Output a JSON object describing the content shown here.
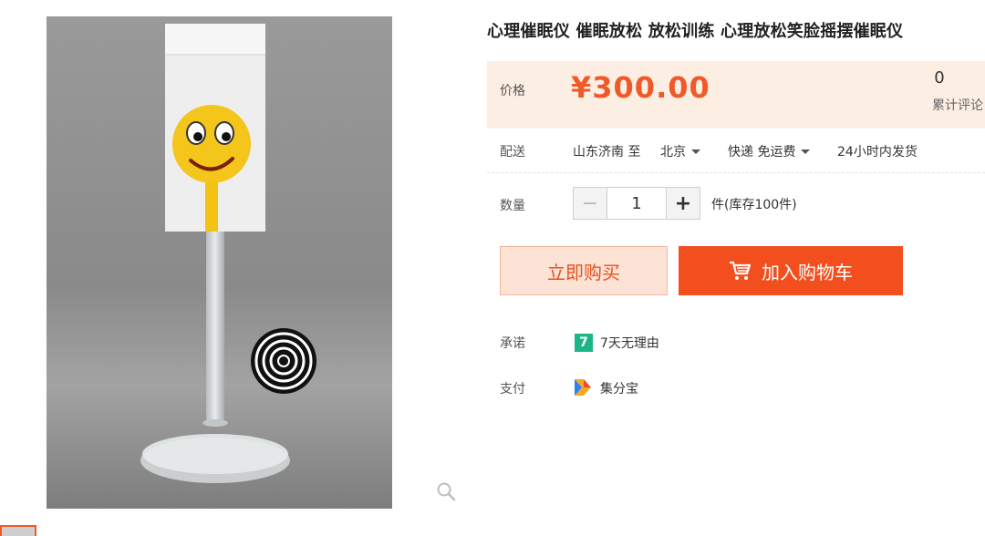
{
  "product": {
    "title": "心理催眠仪 催眠放松 放松训练 心理放松笑脸摇摆催眠仪",
    "image_icon": "smiley-lollipop-product-photo"
  },
  "price": {
    "label": "价格",
    "value": "¥300.00",
    "review_count": "0",
    "review_label": "累计评论",
    "color": "#f05a28"
  },
  "shipping": {
    "label": "配送",
    "from": "山东济南 至",
    "to": "北京",
    "method": "快递 免运费",
    "dispatch": "24小时内发货"
  },
  "quantity": {
    "label": "数量",
    "value": "1",
    "minus": "−",
    "plus": "+",
    "stock": "件(库存100件)"
  },
  "actions": {
    "buy_now": "立即购买",
    "add_to_cart": "加入购物车",
    "accent": "#f24e1e"
  },
  "promise": {
    "label": "承诺",
    "badge": "7",
    "text": "7天无理由"
  },
  "payment": {
    "label": "支付",
    "text": "集分宝"
  }
}
